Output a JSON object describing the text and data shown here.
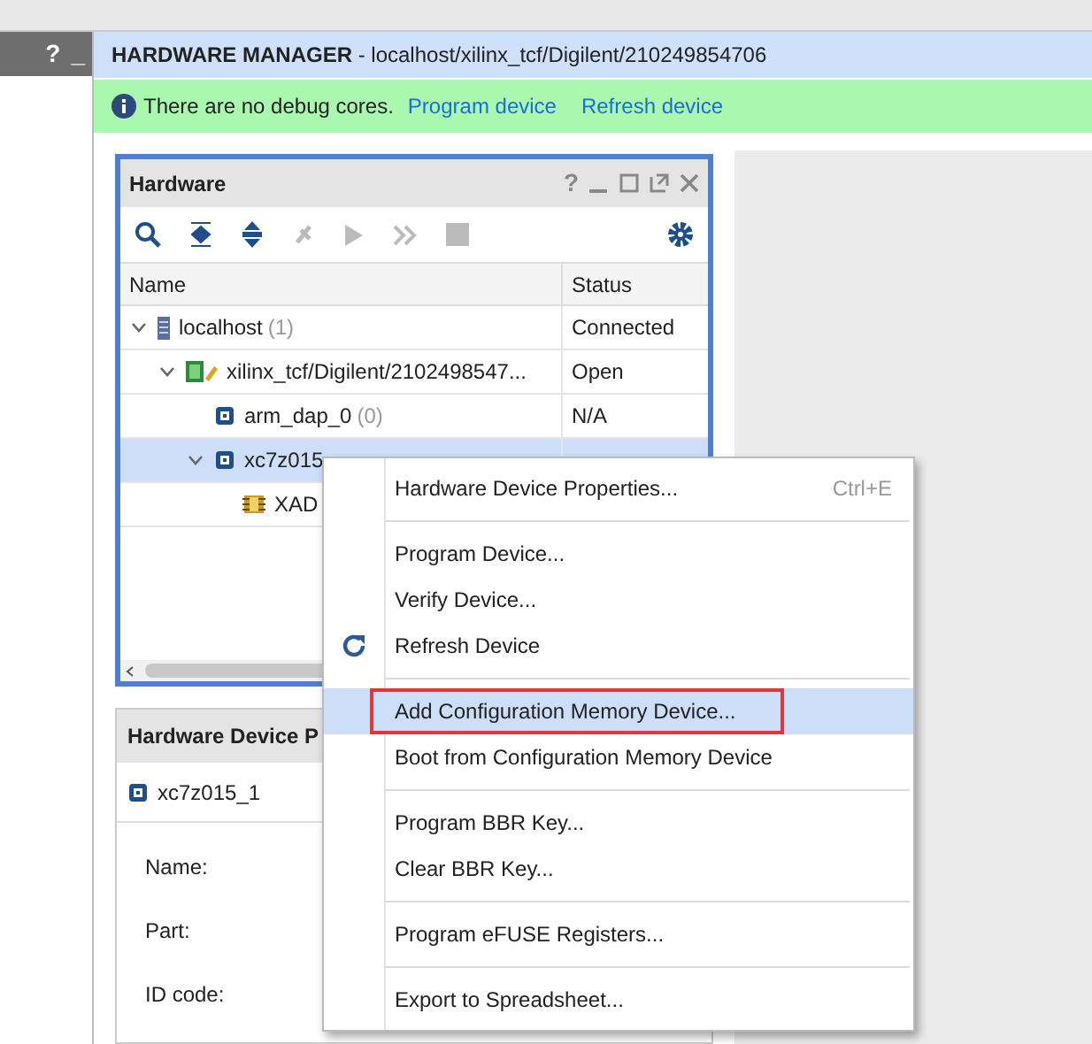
{
  "header": {
    "title": "HARDWARE MANAGER",
    "path": " - localhost/xilinx_tcf/Digilent/210249854706"
  },
  "side_panel": {
    "buttons": [
      "?",
      "_"
    ]
  },
  "banner": {
    "message": "There are no debug cores.",
    "links": [
      "Program device",
      "Refresh device"
    ]
  },
  "hardware": {
    "title": "Hardware",
    "help": "?",
    "columns": [
      "Name",
      "Status"
    ],
    "rows": [
      {
        "kind": "host",
        "name": "localhost",
        "count": "(1)",
        "status": "Connected",
        "expanded": true,
        "selected": false,
        "children": [
          {
            "kind": "target",
            "name": "xilinx_tcf/Digilent/2102498547...",
            "status": "Open",
            "expanded": true,
            "selected": false,
            "children": [
              {
                "kind": "device",
                "name": "arm_dap_0",
                "count": "(0)",
                "status": "N/A",
                "selected": false
              },
              {
                "kind": "device",
                "name": "xc7z015",
                "expanded": true,
                "selected": true,
                "children": [
                  {
                    "kind": "sysmon",
                    "name": "XAD",
                    "selected": false
                  }
                ]
              }
            ]
          }
        ]
      }
    ]
  },
  "properties": {
    "title": "Hardware Device P",
    "device": "xc7z015_1",
    "fields": [
      "Name:",
      "Part:",
      "ID code:"
    ]
  },
  "context_menu": {
    "groups": [
      [
        {
          "kind": "plain",
          "label": "Hardware Device Properties...",
          "shortcut": "Ctrl+E",
          "highlighted": false
        }
      ],
      [
        {
          "kind": "plain",
          "label": "Program Device...",
          "highlighted": false
        },
        {
          "kind": "plain",
          "label": "Verify Device...",
          "highlighted": false
        },
        {
          "kind": "refresh",
          "label": "Refresh Device",
          "highlighted": false
        }
      ],
      [
        {
          "kind": "plain",
          "label": "Add Configuration Memory Device...",
          "highlighted": true
        },
        {
          "kind": "plain",
          "label": "Boot from Configuration Memory Device",
          "highlighted": false
        }
      ],
      [
        {
          "kind": "plain",
          "label": "Program BBR Key...",
          "highlighted": false
        },
        {
          "kind": "plain",
          "label": "Clear BBR Key...",
          "highlighted": false
        }
      ],
      [
        {
          "kind": "plain",
          "label": "Program eFUSE Registers...",
          "highlighted": false
        }
      ],
      [
        {
          "kind": "plain",
          "label": "Export to Spreadsheet...",
          "highlighted": false
        }
      ]
    ]
  }
}
